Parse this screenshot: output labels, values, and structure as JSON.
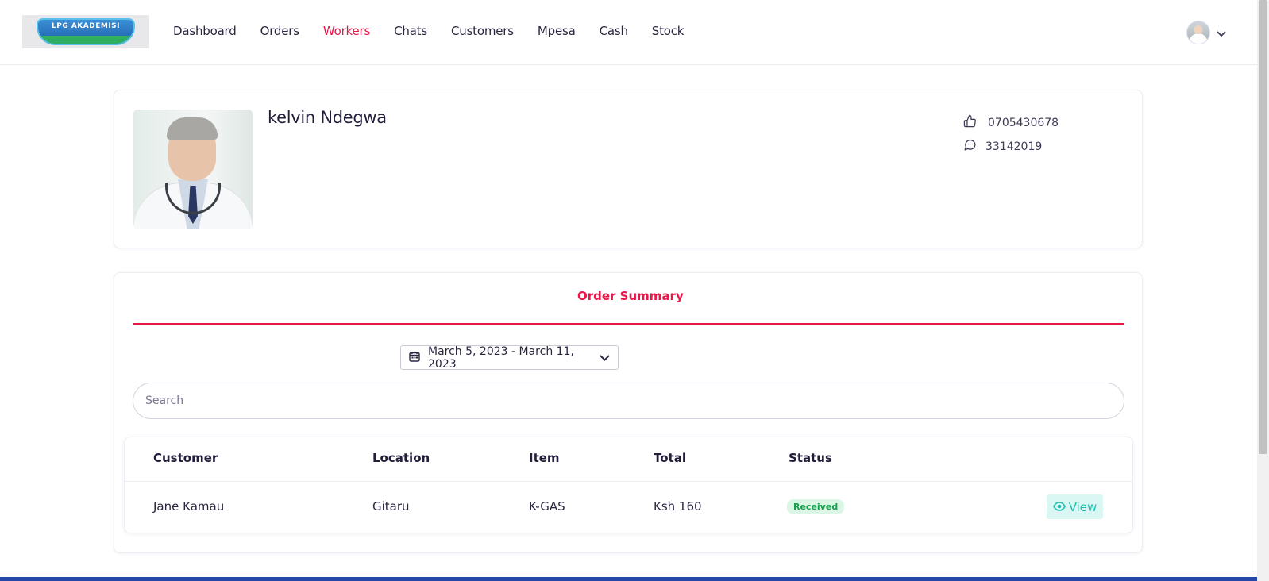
{
  "brand": {
    "logo_text": "LPG AKADEMISI"
  },
  "nav": {
    "items": [
      {
        "label": "Dashboard",
        "active": false
      },
      {
        "label": "Orders",
        "active": false
      },
      {
        "label": "Workers",
        "active": true
      },
      {
        "label": "Chats",
        "active": false
      },
      {
        "label": "Customers",
        "active": false
      },
      {
        "label": "Mpesa",
        "active": false
      },
      {
        "label": "Cash",
        "active": false
      },
      {
        "label": "Stock",
        "active": false
      }
    ],
    "active_color": "#e8174a"
  },
  "profile": {
    "name": "kelvin Ndegwa",
    "phone": "0705430678",
    "id_number": "33142019",
    "phone_icon": "thumbs-up-icon",
    "id_icon": "chat-bubble-icon"
  },
  "orders": {
    "tab_title": "Order Summary",
    "date_range": "March 5, 2023 - March 11, 2023",
    "search_placeholder": "Search",
    "columns": [
      "Customer",
      "Location",
      "Item",
      "Total",
      "Status"
    ],
    "rows": [
      {
        "customer": "Jane Kamau",
        "location": "Gitaru",
        "item": "K-GAS",
        "total": "Ksh 160",
        "status": "Received",
        "action": "View"
      }
    ]
  },
  "colors": {
    "accent": "#e8174a",
    "status_received_bg": "#dcf6e6",
    "status_received_text": "#14a24b",
    "view_button_bg": "#dbf7f3",
    "view_button_text": "#1cbfae",
    "footer_bar": "#2547a8"
  }
}
